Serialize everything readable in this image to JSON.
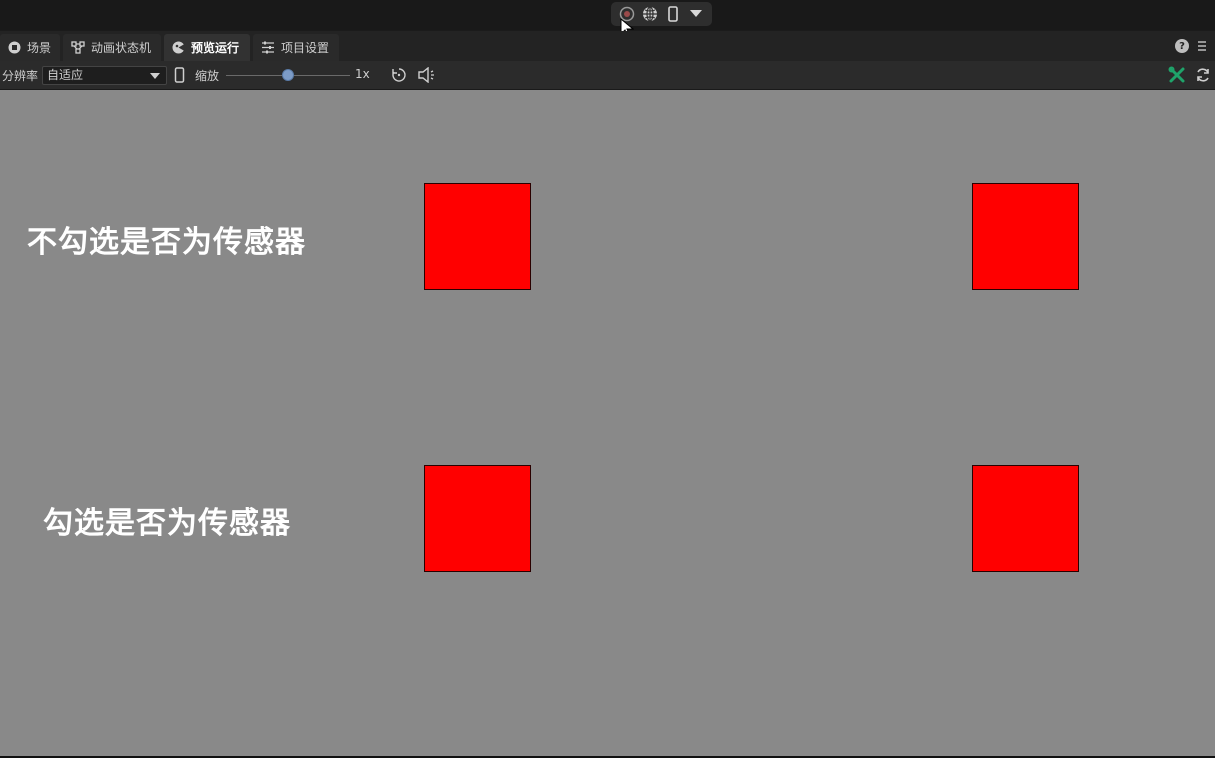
{
  "colors": {
    "viewport_bg": "#898989",
    "box_fill": "#ff0000",
    "accent_green": "#1fa36a"
  },
  "toolbar": {
    "icons": [
      "record-stop-icon",
      "globe-icon",
      "phone-icon",
      "chevron-down-icon"
    ]
  },
  "tabs": [
    {
      "label": "场景",
      "icon": "cube-icon",
      "active": false
    },
    {
      "label": "动画状态机",
      "icon": "node-graph-icon",
      "active": false
    },
    {
      "label": "预览运行",
      "icon": "preview-icon",
      "active": true
    },
    {
      "label": "项目设置",
      "icon": "sliders-icon",
      "active": false
    }
  ],
  "options": {
    "resolution_label": "分辨率",
    "resolution_value": "自适应",
    "zoom_label": "缩放",
    "zoom_value": "1x",
    "zoom_level": 0.5
  },
  "scene": {
    "label_unchecked": "不勾选是否为传感器",
    "label_checked": "勾选是否为传感器"
  }
}
